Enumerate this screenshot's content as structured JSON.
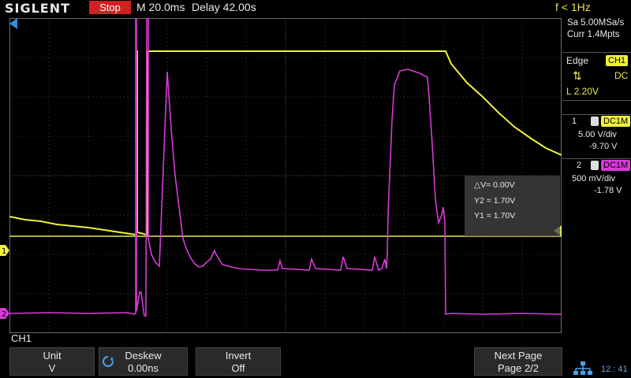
{
  "brand": "SIGLENT",
  "run_state": "Stop",
  "timebase": "M 20.0ms",
  "delay": "Delay 42.00s",
  "freq_counter": "f < 1Hz",
  "acquisition": {
    "sample_rate": "Sa 5.00MSa/s",
    "memory": "Curr 1.4Mpts"
  },
  "trigger": {
    "type": "Edge",
    "source": "CH1",
    "coupling": "DC",
    "level": "L  2.20V"
  },
  "ch1": {
    "number": "1",
    "coupling_impedance": "DC1M",
    "scale": "5.00 V/div",
    "offset": "-9.70 V",
    "color": "#f0f03c"
  },
  "ch2": {
    "number": "2",
    "coupling_impedance": "DC1M",
    "scale": "500 mV/div",
    "offset": "-1.78 V",
    "color": "#d63bd6"
  },
  "cursor_readout": {
    "delta_v": "△V= 0.00V",
    "y2": "Y2 = 1.70V",
    "y1": "Y1 = 1.70V"
  },
  "menu": {
    "title": "CH1",
    "softkeys": [
      {
        "top": "Unit",
        "bottom": "V"
      },
      {
        "top": "Deskew",
        "bottom": "0.00ns"
      },
      {
        "top": "Invert",
        "bottom": "Off"
      },
      {
        "top": "Next Page",
        "bottom": "Page 2/2"
      }
    ]
  },
  "clock": "12 : 41",
  "icons": [
    "trigger-position-icon",
    "trigger-level-icon",
    "ch1-ground-marker",
    "ch2-ground-marker",
    "knob-icon",
    "network-icon",
    "rise-fall-icon"
  ]
}
